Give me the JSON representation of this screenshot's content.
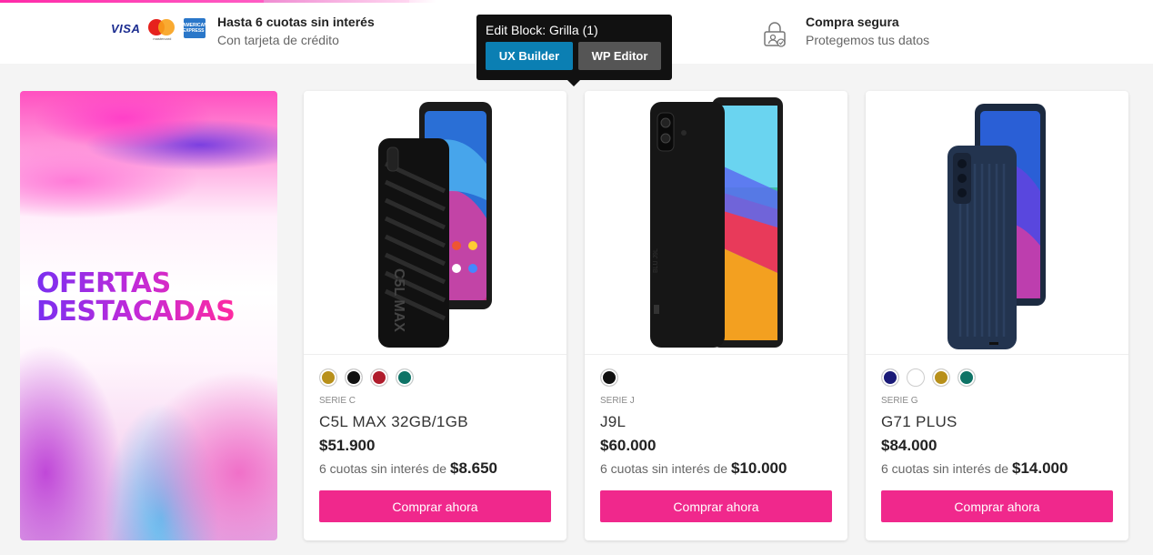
{
  "payment": {
    "visa_label": "VISA",
    "mastercard_label": "mastercard",
    "amex_label": "AMERICAN EXPRESS",
    "title": "Hasta 6 cuotas sin interés",
    "subtitle": "Con tarjeta de crédito"
  },
  "security": {
    "icon": "lock-user-icon",
    "title": "Compra segura",
    "subtitle": "Protegemos tus datos"
  },
  "edit_tooltip": {
    "title": "Edit Block: Grilla (1)",
    "ux_builder": "UX Builder",
    "wp_editor": "WP Editor"
  },
  "promo": {
    "line1": "OFERTAS",
    "line2": "DESTACADAS"
  },
  "products": [
    {
      "serie": "SERIE C",
      "name": "C5L MAX 32GB/1GB",
      "price": "$51.900",
      "cuotas_text": "6 cuotas sin interés de",
      "cuota_value": "$8.650",
      "button": "Comprar ahora",
      "colors": [
        "#b8901a",
        "#111111",
        "#b01c2c",
        "#0e7366"
      ]
    },
    {
      "serie": "SERIE J",
      "name": "J9L",
      "price": "$60.000",
      "cuotas_text": "6 cuotas sin interés de",
      "cuota_value": "$10.000",
      "button": "Comprar ahora",
      "colors": [
        "#111111"
      ]
    },
    {
      "serie": "SERIE G",
      "name": "G71 PLUS",
      "price": "$84.000",
      "cuotas_text": "6 cuotas sin interés de",
      "cuota_value": "$14.000",
      "button": "Comprar ahora",
      "colors": [
        "#1a1a78",
        "#ffffff",
        "#b8901a",
        "#0e7366"
      ]
    }
  ],
  "colors": {
    "accent": "#f0288c",
    "tooltip_primary": "#0b7fb3"
  }
}
